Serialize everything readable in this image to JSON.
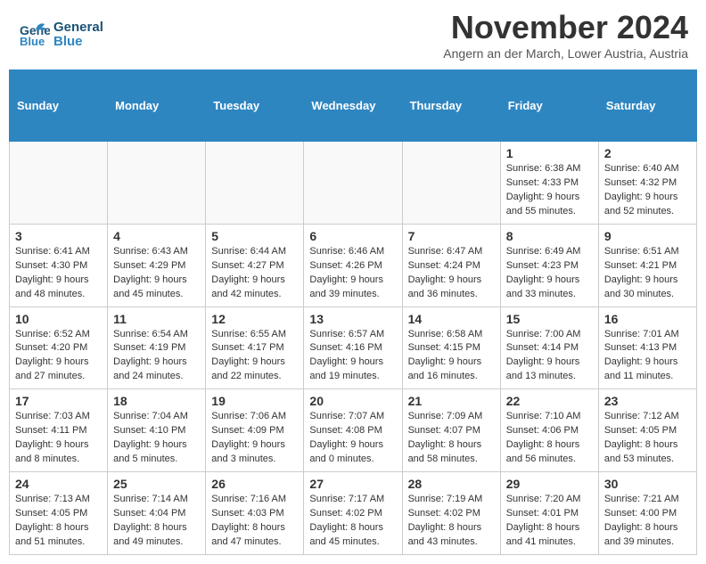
{
  "header": {
    "logo_line1": "General",
    "logo_line2": "Blue",
    "title": "November 2024",
    "location": "Angern an der March, Lower Austria, Austria"
  },
  "calendar": {
    "weekdays": [
      "Sunday",
      "Monday",
      "Tuesday",
      "Wednesday",
      "Thursday",
      "Friday",
      "Saturday"
    ],
    "weeks": [
      [
        {
          "day": "",
          "info": ""
        },
        {
          "day": "",
          "info": ""
        },
        {
          "day": "",
          "info": ""
        },
        {
          "day": "",
          "info": ""
        },
        {
          "day": "",
          "info": ""
        },
        {
          "day": "1",
          "info": "Sunrise: 6:38 AM\nSunset: 4:33 PM\nDaylight: 9 hours and 55 minutes."
        },
        {
          "day": "2",
          "info": "Sunrise: 6:40 AM\nSunset: 4:32 PM\nDaylight: 9 hours and 52 minutes."
        }
      ],
      [
        {
          "day": "3",
          "info": "Sunrise: 6:41 AM\nSunset: 4:30 PM\nDaylight: 9 hours and 48 minutes."
        },
        {
          "day": "4",
          "info": "Sunrise: 6:43 AM\nSunset: 4:29 PM\nDaylight: 9 hours and 45 minutes."
        },
        {
          "day": "5",
          "info": "Sunrise: 6:44 AM\nSunset: 4:27 PM\nDaylight: 9 hours and 42 minutes."
        },
        {
          "day": "6",
          "info": "Sunrise: 6:46 AM\nSunset: 4:26 PM\nDaylight: 9 hours and 39 minutes."
        },
        {
          "day": "7",
          "info": "Sunrise: 6:47 AM\nSunset: 4:24 PM\nDaylight: 9 hours and 36 minutes."
        },
        {
          "day": "8",
          "info": "Sunrise: 6:49 AM\nSunset: 4:23 PM\nDaylight: 9 hours and 33 minutes."
        },
        {
          "day": "9",
          "info": "Sunrise: 6:51 AM\nSunset: 4:21 PM\nDaylight: 9 hours and 30 minutes."
        }
      ],
      [
        {
          "day": "10",
          "info": "Sunrise: 6:52 AM\nSunset: 4:20 PM\nDaylight: 9 hours and 27 minutes."
        },
        {
          "day": "11",
          "info": "Sunrise: 6:54 AM\nSunset: 4:19 PM\nDaylight: 9 hours and 24 minutes."
        },
        {
          "day": "12",
          "info": "Sunrise: 6:55 AM\nSunset: 4:17 PM\nDaylight: 9 hours and 22 minutes."
        },
        {
          "day": "13",
          "info": "Sunrise: 6:57 AM\nSunset: 4:16 PM\nDaylight: 9 hours and 19 minutes."
        },
        {
          "day": "14",
          "info": "Sunrise: 6:58 AM\nSunset: 4:15 PM\nDaylight: 9 hours and 16 minutes."
        },
        {
          "day": "15",
          "info": "Sunrise: 7:00 AM\nSunset: 4:14 PM\nDaylight: 9 hours and 13 minutes."
        },
        {
          "day": "16",
          "info": "Sunrise: 7:01 AM\nSunset: 4:13 PM\nDaylight: 9 hours and 11 minutes."
        }
      ],
      [
        {
          "day": "17",
          "info": "Sunrise: 7:03 AM\nSunset: 4:11 PM\nDaylight: 9 hours and 8 minutes."
        },
        {
          "day": "18",
          "info": "Sunrise: 7:04 AM\nSunset: 4:10 PM\nDaylight: 9 hours and 5 minutes."
        },
        {
          "day": "19",
          "info": "Sunrise: 7:06 AM\nSunset: 4:09 PM\nDaylight: 9 hours and 3 minutes."
        },
        {
          "day": "20",
          "info": "Sunrise: 7:07 AM\nSunset: 4:08 PM\nDaylight: 9 hours and 0 minutes."
        },
        {
          "day": "21",
          "info": "Sunrise: 7:09 AM\nSunset: 4:07 PM\nDaylight: 8 hours and 58 minutes."
        },
        {
          "day": "22",
          "info": "Sunrise: 7:10 AM\nSunset: 4:06 PM\nDaylight: 8 hours and 56 minutes."
        },
        {
          "day": "23",
          "info": "Sunrise: 7:12 AM\nSunset: 4:05 PM\nDaylight: 8 hours and 53 minutes."
        }
      ],
      [
        {
          "day": "24",
          "info": "Sunrise: 7:13 AM\nSunset: 4:05 PM\nDaylight: 8 hours and 51 minutes."
        },
        {
          "day": "25",
          "info": "Sunrise: 7:14 AM\nSunset: 4:04 PM\nDaylight: 8 hours and 49 minutes."
        },
        {
          "day": "26",
          "info": "Sunrise: 7:16 AM\nSunset: 4:03 PM\nDaylight: 8 hours and 47 minutes."
        },
        {
          "day": "27",
          "info": "Sunrise: 7:17 AM\nSunset: 4:02 PM\nDaylight: 8 hours and 45 minutes."
        },
        {
          "day": "28",
          "info": "Sunrise: 7:19 AM\nSunset: 4:02 PM\nDaylight: 8 hours and 43 minutes."
        },
        {
          "day": "29",
          "info": "Sunrise: 7:20 AM\nSunset: 4:01 PM\nDaylight: 8 hours and 41 minutes."
        },
        {
          "day": "30",
          "info": "Sunrise: 7:21 AM\nSunset: 4:00 PM\nDaylight: 8 hours and 39 minutes."
        }
      ]
    ]
  }
}
